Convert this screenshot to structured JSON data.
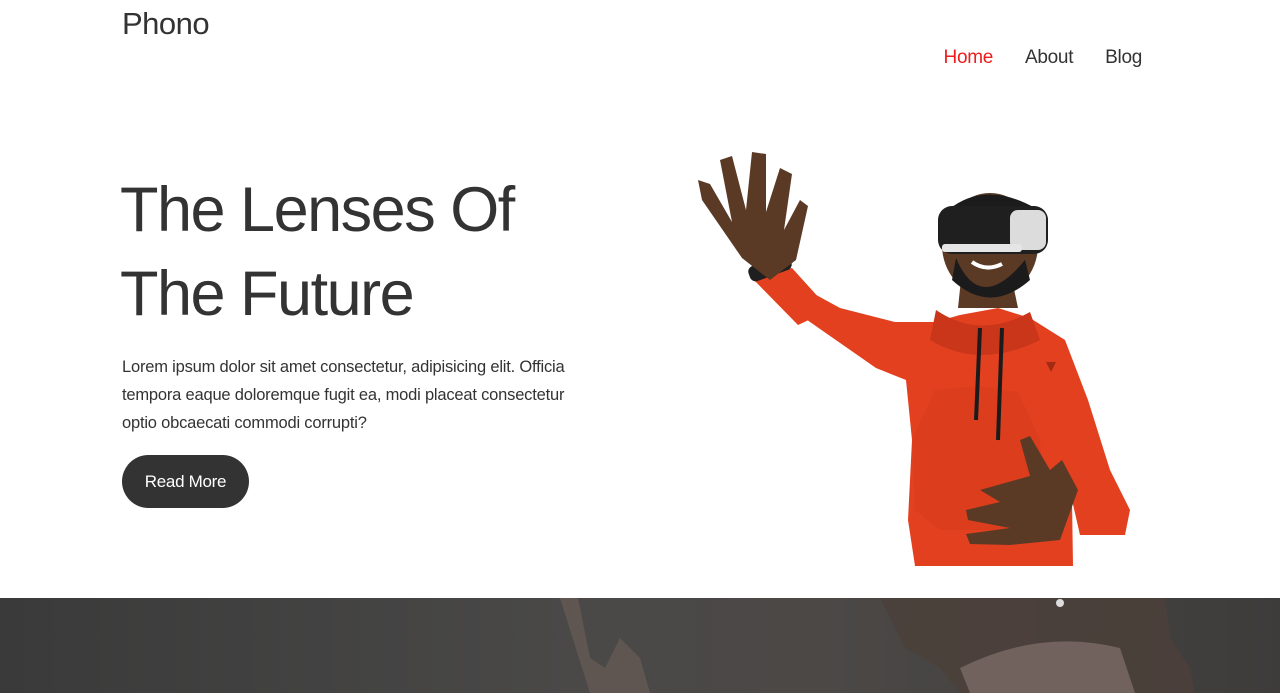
{
  "header": {
    "logo": "Phono",
    "nav": [
      {
        "label": "Home",
        "active": true
      },
      {
        "label": "About",
        "active": false
      },
      {
        "label": "Blog",
        "active": false
      }
    ]
  },
  "hero": {
    "title_line1": "The Lenses Of",
    "title_line2": "The Future",
    "description": "Lorem ipsum dolor sit amet consectetur, adipisicing elit. Officia tempora eaque doloremque fugit ea, modi placeat consectetur optio obcaecati commodi corrupti?",
    "button_label": "Read More"
  },
  "colors": {
    "accent": "#ee1c1c",
    "text": "#333333",
    "button": "#333333",
    "hoodie": "#e3401f",
    "banner": "#444342"
  }
}
